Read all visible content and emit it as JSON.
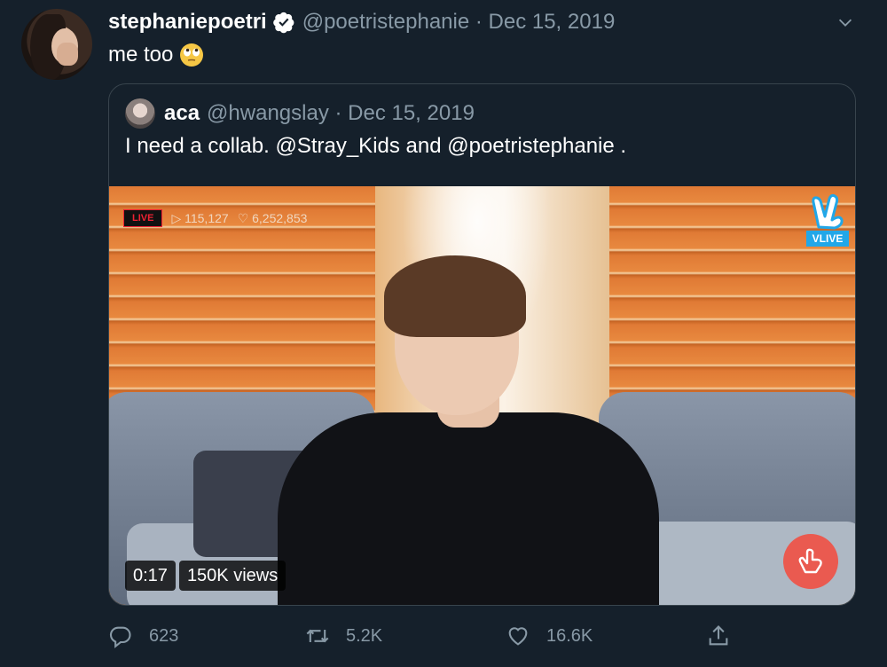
{
  "tweet": {
    "display_name": "stephaniepoetri",
    "handle_date": "@poetristephanie · Dec 15, 2019",
    "text": "me too",
    "emoji": "face-with-rolling-eyes"
  },
  "quote": {
    "display_name": "aca",
    "handle_date": "@hwangslay · Dec 15, 2019",
    "text": "I need a collab. @Stray_Kids and @poetristephanie ."
  },
  "video": {
    "live_label": "LIVE",
    "live_views": "▷ 115,127",
    "live_hearts": "♡ 6,252,853",
    "watermark": "VLIVE",
    "time": "0:17",
    "views": "150K views"
  },
  "actions": {
    "replies": "623",
    "retweets": "5.2K",
    "likes": "16.6K"
  },
  "colors": {
    "background": "#15202b",
    "secondary_text": "#8899a6",
    "border": "#38444d",
    "verified": "#ffffff"
  }
}
